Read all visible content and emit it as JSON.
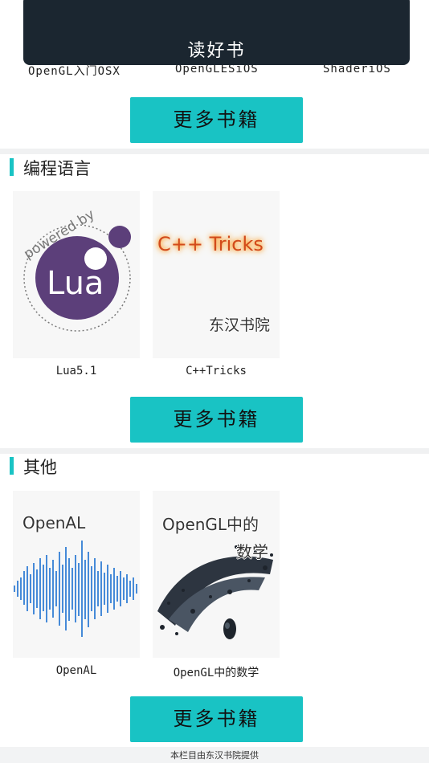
{
  "header": {
    "title": "读好书"
  },
  "top_section": {
    "book_titles": [
      "OpenGL入门OSX",
      "OpenGLESiOS",
      "ShaderiOS"
    ],
    "more_label": "更多书籍"
  },
  "sections": [
    {
      "title": "编程语言",
      "books": [
        {
          "title": "Lua5.1",
          "cover_text": [
            "powered by",
            "Lua"
          ]
        },
        {
          "title": "C++Tricks",
          "cover_text": [
            "C++ Tricks",
            "东汉书院"
          ]
        }
      ],
      "more_label": "更多书籍"
    },
    {
      "title": "其他",
      "books": [
        {
          "title": "OpenAL",
          "cover_text": [
            "OpenAL"
          ]
        },
        {
          "title": "OpenGL中的数学",
          "cover_text": [
            "OpenGL中的",
            "数学"
          ]
        }
      ],
      "more_label": "更多书籍"
    }
  ],
  "footer": {
    "text": "本栏目由东汉书院提供"
  },
  "colors": {
    "accent": "#19c3c4",
    "overlay": "#1b2630"
  }
}
